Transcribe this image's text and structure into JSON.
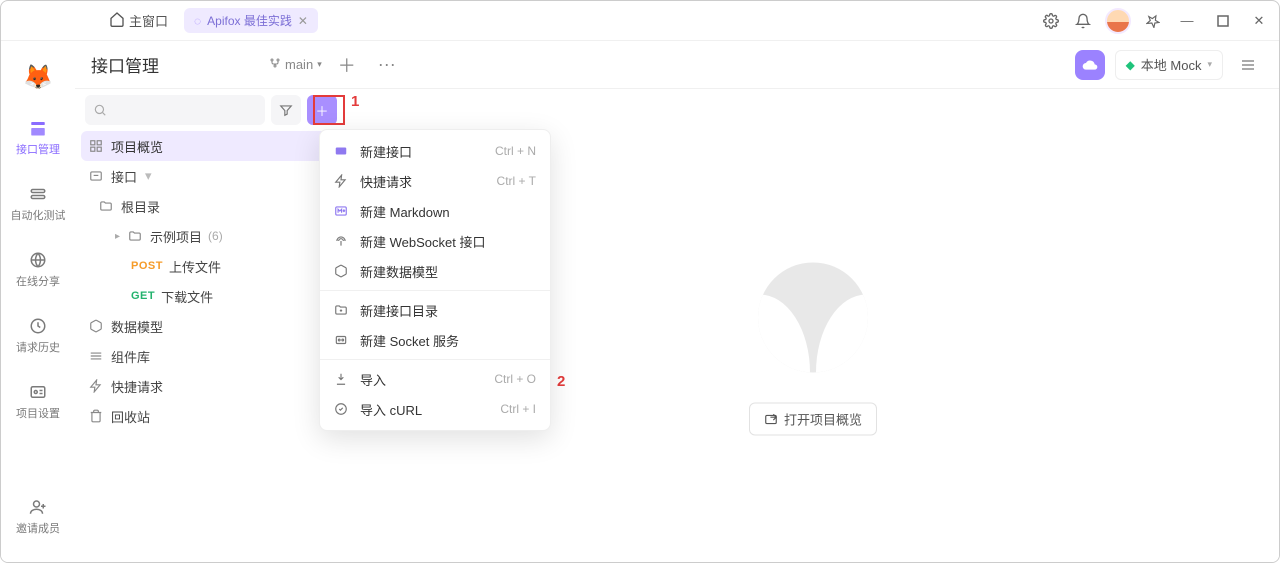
{
  "titlebar": {
    "home_label": "主窗口",
    "tab_label": "Apifox 最佳实践"
  },
  "rail": {
    "items": [
      {
        "label": "接口管理"
      },
      {
        "label": "自动化测试"
      },
      {
        "label": "在线分享"
      },
      {
        "label": "请求历史"
      },
      {
        "label": "项目设置"
      }
    ],
    "invite_label": "邀请成员"
  },
  "topbar": {
    "title": "接口管理",
    "branch": "main",
    "env_label": "本地 Mock"
  },
  "sidebar": {
    "project_overview": "项目概览",
    "api_root": "接口",
    "root_dir": "根目录",
    "example_project": "示例项目",
    "example_count": "(6)",
    "upload_label": "上传文件",
    "download_label": "下载文件",
    "method_post": "POST",
    "method_get": "GET",
    "data_models": "数据模型",
    "components": "组件库",
    "quick_request": "快捷请求",
    "recycle": "回收站"
  },
  "menu": {
    "items": [
      {
        "label": "新建接口",
        "shortcut": "Ctrl + N"
      },
      {
        "label": "快捷请求",
        "shortcut": "Ctrl + T"
      },
      {
        "label": "新建 Markdown",
        "shortcut": ""
      },
      {
        "label": "新建 WebSocket 接口",
        "shortcut": ""
      },
      {
        "label": "新建数据模型",
        "shortcut": ""
      },
      {
        "label": "新建接口目录",
        "shortcut": ""
      },
      {
        "label": "新建 Socket 服务",
        "shortcut": ""
      },
      {
        "label": "导入",
        "shortcut": "Ctrl + O"
      },
      {
        "label": "导入 cURL",
        "shortcut": "Ctrl + I"
      }
    ]
  },
  "canvas": {
    "open_project": "打开项目概览"
  },
  "annotations": {
    "one": "1",
    "two": "2"
  }
}
